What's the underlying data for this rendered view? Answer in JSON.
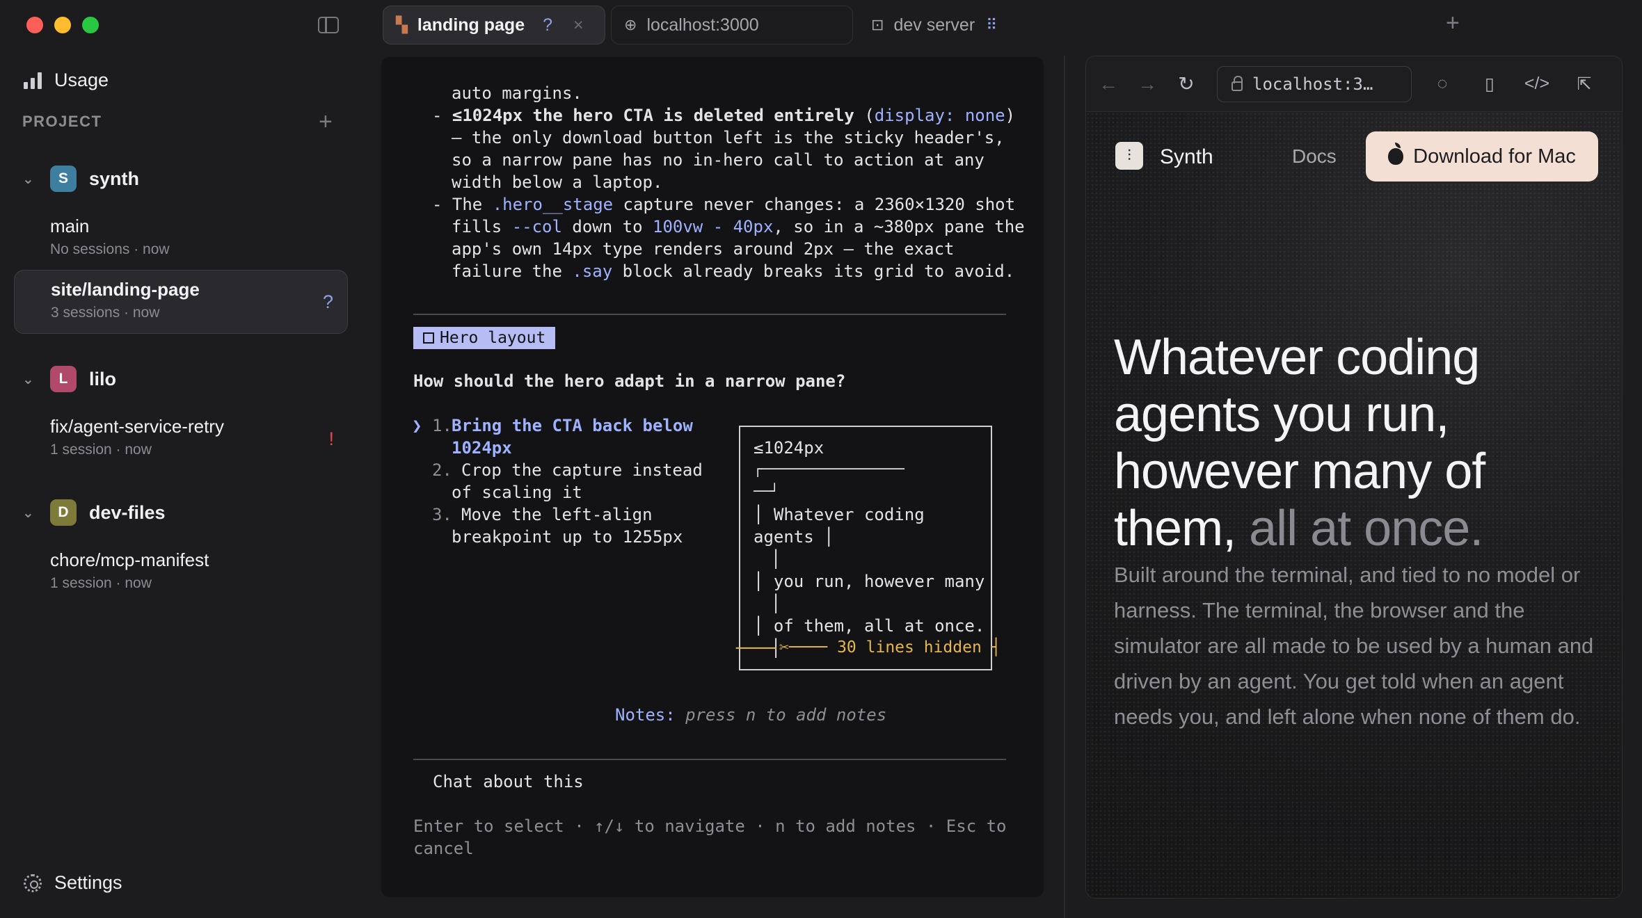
{
  "sidebar": {
    "usage_label": "Usage",
    "project_label": "PROJECT",
    "groups": [
      {
        "letter": "S",
        "name": "synth",
        "color": "#3e7fa0"
      },
      {
        "letter": "L",
        "name": "lilo",
        "color": "#b14a6a"
      },
      {
        "letter": "D",
        "name": "dev-files",
        "color": "#7e7a3a"
      }
    ],
    "sessions": [
      {
        "name": "main",
        "sub": "No sessions · now"
      },
      {
        "name": "site/landing-page",
        "sub": "3 sessions · now",
        "mark": "?"
      },
      {
        "name": "fix/agent-service-retry",
        "sub": "1 session · now",
        "mark": "!"
      },
      {
        "name": "chore/mcp-manifest",
        "sub": "1 session · now"
      }
    ],
    "settings_label": "Settings"
  },
  "tabs": [
    {
      "label": "landing page",
      "mark": "?",
      "close": "×"
    },
    {
      "label": "localhost:3000"
    },
    {
      "label": "dev server"
    }
  ],
  "terminal": {
    "lines": {
      "l1": "auto margins.",
      "l2a": "- ",
      "l2b": "≤1024px the hero CTA is deleted entirely",
      "l2c": " (",
      "l2d": "display: none",
      "l2e": ")",
      "l3": "— the only download button left is the sticky header's,",
      "l4": "so a narrow pane has no in-hero call to action at any",
      "l5": "width below a laptop.",
      "l6a": "- The ",
      "l6b": ".hero__stage",
      "l6c": " capture never changes: a 2360×1320 shot",
      "l7a": "fills ",
      "l7b": "--col",
      "l7c": " down to ",
      "l7d": "100vw - 40px",
      "l7e": ", so in a ~380px pane the",
      "l8": "app's own 14px type renders around 2px — the exact",
      "l9a": "failure the ",
      "l9b": ".say",
      "l9c": " block already breaks its grid to avoid."
    },
    "chip_label": "Hero layout",
    "question": "How should the hero adapt in a narrow pane?",
    "options": [
      {
        "num": "1.",
        "text": [
          "Bring the CTA back below",
          "1024px"
        ]
      },
      {
        "num": "2.",
        "text": [
          "Crop the capture instead",
          "of scaling it"
        ]
      },
      {
        "num": "3.",
        "text": [
          "Move the left-align",
          "breakpoint up to 1255px"
        ]
      }
    ],
    "cursor": "❯",
    "preview": {
      "heading": "≤1024px",
      "lines": [
        "┌─────────────────",
        "──┘",
        "│ Whatever coding",
        "agents │",
        "│",
        "│ you run, however many",
        "│",
        "│ of them, all at once.",
        "│"
      ],
      "hidden_left": "──── ",
      "hidden_mid": "✂──── 30 lines hidden ┤"
    },
    "notes_label": "Notes:",
    "notes_hint": "press n to add notes",
    "chat": "Chat about this",
    "footer": [
      "Enter to select · ↑/↓ to navigate · n to add notes · Esc to",
      "cancel"
    ]
  },
  "browser": {
    "url": "localhost:3…",
    "site": {
      "brand": "Synth",
      "docs": "Docs",
      "download": "Download for Mac",
      "hero_main": "Whatever coding agents you run, however many of them,",
      "hero_dim": "all at once.",
      "sub": "Built around the terminal, and tied to no model or harness. The terminal, the browser and the simulator are all made to be used by a human and driven by an agent. You get told when an agent needs you, and left alone when none of them do."
    }
  },
  "colors": {
    "traffic_red": "#ff5f57",
    "traffic_yellow": "#febc2e",
    "traffic_green": "#28c840",
    "accent_blue": "#9fb2ff",
    "accent_yellow": "#e7b64c",
    "alert_red": "#e5484d",
    "cta_bg": "#f4dfd4"
  }
}
